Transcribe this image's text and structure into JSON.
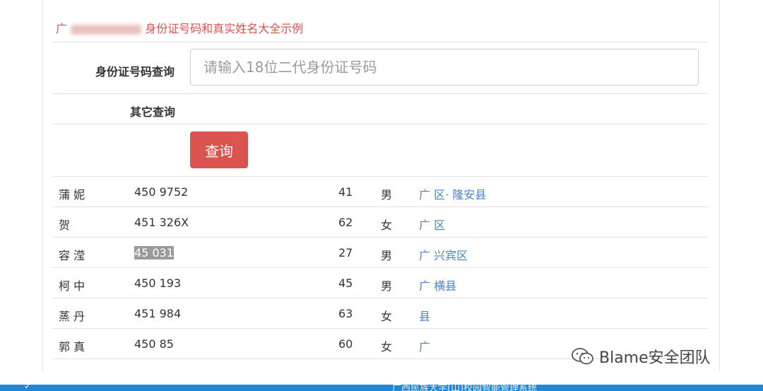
{
  "header": {
    "title_prefix": "广",
    "title_text": "身份证号码和真实姓名大全示例"
  },
  "search": {
    "id_label": "身份证号码查询",
    "id_placeholder": "请输入18位二代身份证号码",
    "other_label": "其它查询",
    "query_button": "查询"
  },
  "results": [
    {
      "name": "蒲 妮",
      "id": "450 9752",
      "age": "41",
      "sex": "男",
      "address": "广 区· 隆安县",
      "selected": false
    },
    {
      "name": "贺",
      "id": "451 326X",
      "age": "62",
      "sex": "女",
      "address": "广 区",
      "selected": false
    },
    {
      "name": "容 滢",
      "id": "45 031",
      "age": "27",
      "sex": "男",
      "address": "广 兴宾区",
      "selected": true
    },
    {
      "name": "柯 中",
      "id": "450 193",
      "age": "45",
      "sex": "男",
      "address": "广 横县",
      "selected": false
    },
    {
      "name": "蒸 丹",
      "id": "451 984",
      "age": "63",
      "sex": "女",
      "address": "县",
      "selected": false
    },
    {
      "name": "郭 真",
      "id": "450 85",
      "age": "60",
      "sex": "女",
      "address": "广",
      "selected": false
    }
  ],
  "watermark": {
    "text": "Blame安全团队",
    "icon": "wechat-icon"
  },
  "bottom_bar": {
    "text": "广西民族大学(山)校园智能管理系统"
  },
  "colors": {
    "accent": "#d9534f",
    "link": "#4a83c6",
    "bar": "#1e88d6"
  }
}
